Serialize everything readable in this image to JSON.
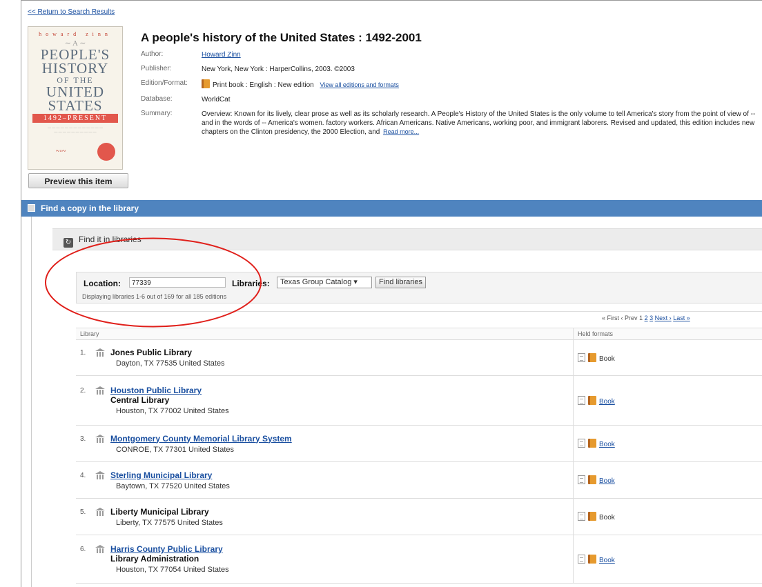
{
  "nav": {
    "back_link": "<< Return to Search Results"
  },
  "cover": {
    "author_text": "howard zinn",
    "title_lines": [
      "A",
      "PEOPLE'S",
      "HISTORY",
      "OF THE",
      "UNITED",
      "STATES"
    ],
    "band_text": "1492–PRESENT"
  },
  "preview_button": "Preview this item",
  "record": {
    "title": "A people's history of the United States : 1492-2001",
    "author_label": "Author:",
    "author": "Howard Zinn",
    "publisher_label": "Publisher:",
    "publisher": "New York, New York : HarperCollins, 2003. ©2003",
    "edition_label": "Edition/Format:",
    "edition": "Print book : English : New edition",
    "editions_link": "View all editions and formats",
    "database_label": "Database:",
    "database": "WorldCat",
    "summary_label": "Summary:",
    "summary": "Overview: Known for its lively, clear prose as well as its scholarly research. A People's History of the United States is the only volume to tell America's story from the point of view of -- and in the words of -- America's women. factory workers. African Americans. Native Americans, working poor, and immigrant laborers. Revised and updated, this edition includes new chapters on the Clinton presidency, the 2000 Election, and",
    "read_more": "Read more..."
  },
  "find_copy": {
    "section_title": "Find a copy in the library",
    "subsection_title": "Find it in libraries",
    "location_label": "Location:",
    "location_value": "77339",
    "libraries_label": "Libraries:",
    "libraries_selected": "Texas Group Catalog",
    "find_button": "Find libraries",
    "display_count": "Displaying libraries 1-6 out of 169 for all 185 editions"
  },
  "pager": {
    "first": "« First",
    "prev": "‹ Prev",
    "page1": "1",
    "page2": "2",
    "page3": "3",
    "next": "Next ›",
    "last": "Last »"
  },
  "table": {
    "col_library": "Library",
    "col_formats": "Held formats",
    "rows": [
      {
        "num": "1.",
        "name": "Jones Public Library",
        "branch": "",
        "address": "Dayton, TX 77535 United States",
        "format": "Book"
      },
      {
        "num": "2.",
        "name": "Houston Public Library",
        "branch": "Central Library",
        "address": "Houston, TX 77002 United States",
        "format": "Book"
      },
      {
        "num": "3.",
        "name": "Montgomery County Memorial Library System",
        "branch": "",
        "address": "CONROE, TX 77301 United States",
        "format": "Book"
      },
      {
        "num": "4.",
        "name": "Sterling Municipal Library",
        "branch": "",
        "address": "Baytown, TX 77520 United States",
        "format": "Book"
      },
      {
        "num": "5.",
        "name": "Liberty Municipal Library",
        "branch": "",
        "address": "Liberty, TX 77575 United States",
        "format": "Book"
      },
      {
        "num": "6.",
        "name": "Harris County Public Library",
        "branch": "Library Administration",
        "address": "Houston, TX 77054 United States",
        "format": "Book"
      }
    ]
  },
  "annotation": {
    "ellipse_color": "#e0201b"
  },
  "colors": {
    "section_bar": "#4f84bf",
    "link": "#1a4fa0"
  }
}
